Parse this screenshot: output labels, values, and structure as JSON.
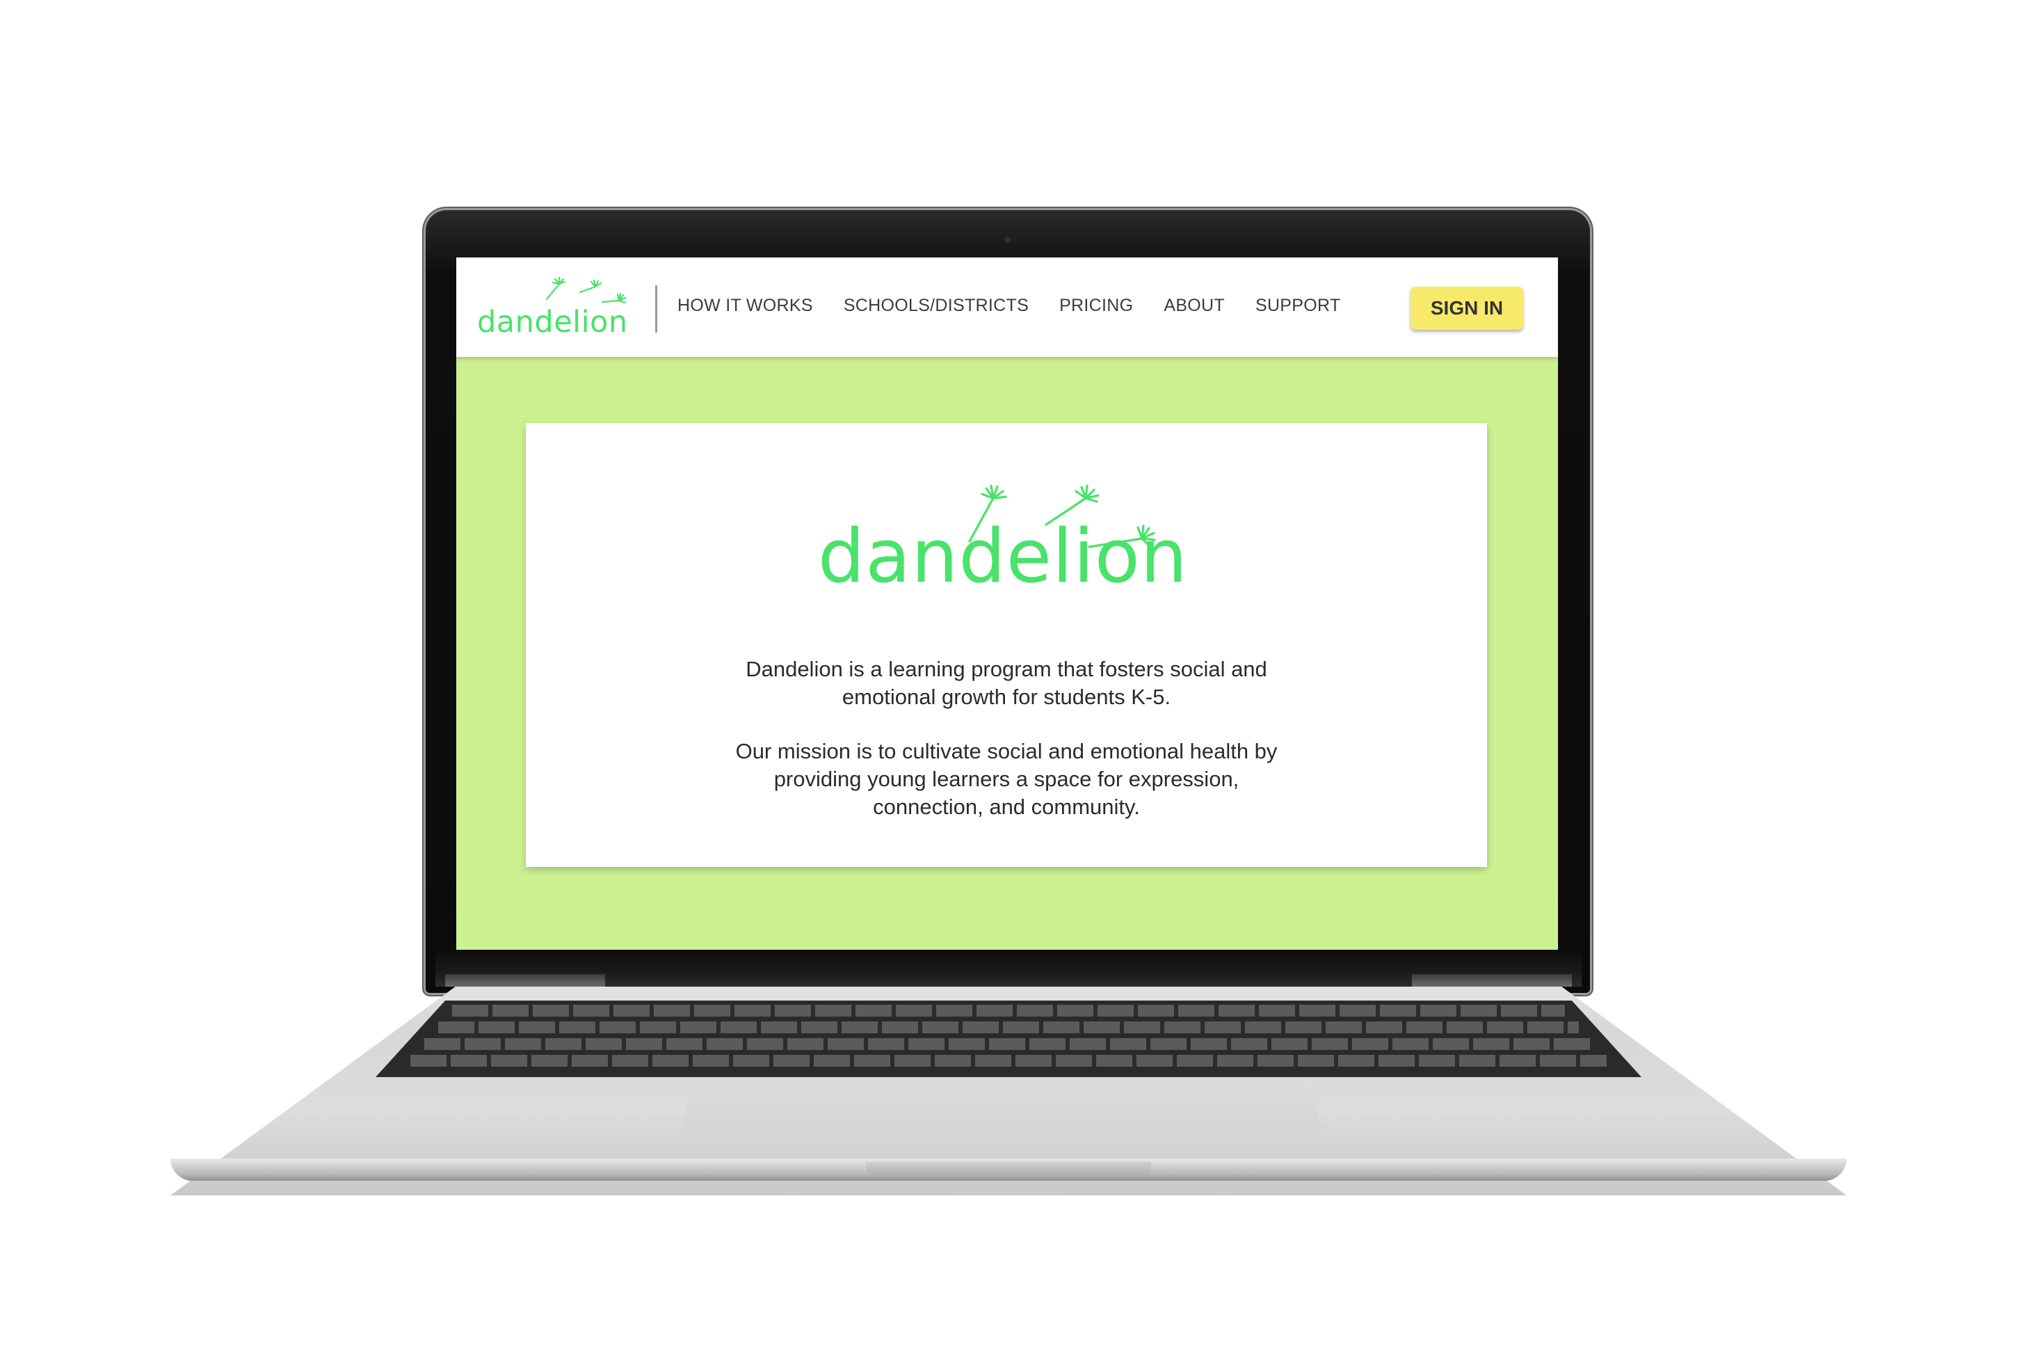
{
  "nav": {
    "logo_text": "dandelion",
    "links": [
      {
        "label": "HOW IT WORKS"
      },
      {
        "label": "SCHOOLS/DISTRICTS"
      },
      {
        "label": "PRICING"
      },
      {
        "label": "ABOUT"
      },
      {
        "label": "SUPPORT"
      }
    ],
    "signin_label": "SIGN IN"
  },
  "hero": {
    "logo_text": "dandelion",
    "paragraph_1": "Dandelion is a learning program that fosters social and emotional growth for students K-5.",
    "paragraph_2": "Our mission is to cultivate social and emotional health by providing young learners a space for expression, connection, and community."
  },
  "colors": {
    "brand_green": "#49e26a",
    "page_background": "#cdf191",
    "signin_yellow": "#f7e96a"
  }
}
